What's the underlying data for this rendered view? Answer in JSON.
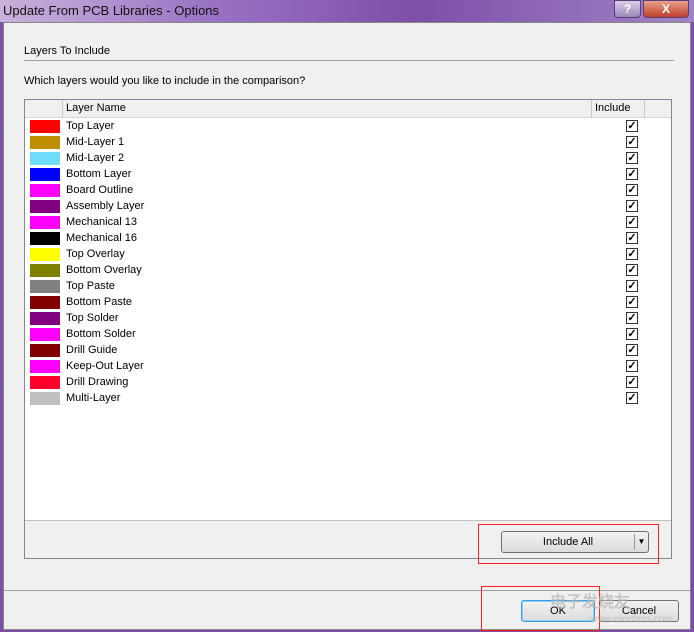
{
  "window": {
    "title": "Update From PCB Libraries - Options",
    "help": "?",
    "close": "X"
  },
  "section": {
    "title": "Layers To Include",
    "question": "Which layers would you like to include in the comparison?"
  },
  "table": {
    "col_name": "Layer Name",
    "col_include": "Include",
    "rows": [
      {
        "name": "Top Layer",
        "color": "#FF0000",
        "checked": true
      },
      {
        "name": "Mid-Layer 1",
        "color": "#BC8E00",
        "checked": true
      },
      {
        "name": "Mid-Layer 2",
        "color": "#70DBFA",
        "checked": true
      },
      {
        "name": "Bottom Layer",
        "color": "#0000FF",
        "checked": true
      },
      {
        "name": "Board Outline",
        "color": "#FF00FF",
        "checked": true
      },
      {
        "name": "Assembly Layer",
        "color": "#800080",
        "checked": true
      },
      {
        "name": "Mechanical 13",
        "color": "#FF00FF",
        "checked": true
      },
      {
        "name": "Mechanical 16",
        "color": "#000000",
        "checked": true
      },
      {
        "name": "Top Overlay",
        "color": "#FFFF00",
        "checked": true
      },
      {
        "name": "Bottom Overlay",
        "color": "#808000",
        "checked": true
      },
      {
        "name": "Top Paste",
        "color": "#808080",
        "checked": true
      },
      {
        "name": "Bottom Paste",
        "color": "#800000",
        "checked": true
      },
      {
        "name": "Top Solder",
        "color": "#800080",
        "checked": true
      },
      {
        "name": "Bottom Solder",
        "color": "#FF00FF",
        "checked": true
      },
      {
        "name": "Drill Guide",
        "color": "#800000",
        "checked": true
      },
      {
        "name": "Keep-Out Layer",
        "color": "#FF00FF",
        "checked": true
      },
      {
        "name": "Drill Drawing",
        "color": "#FF002A",
        "checked": true
      },
      {
        "name": "Multi-Layer",
        "color": "#C0C0C0",
        "checked": true
      }
    ]
  },
  "buttons": {
    "include_all": "Include All",
    "ok": "OK",
    "cancel": "Cancel"
  },
  "watermark": {
    "text": "电子发烧友",
    "url": "www.elecfans.com"
  }
}
